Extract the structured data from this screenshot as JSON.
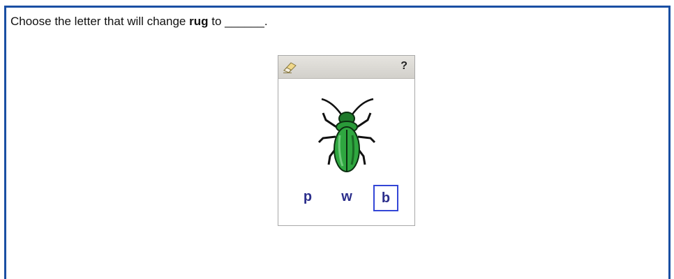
{
  "question": {
    "prefix": "Choose the letter that will change ",
    "word": "rug",
    "suffix": " to ______."
  },
  "widget": {
    "help_label": "?",
    "eraser_icon": "eraser-icon",
    "picture_icon": "beetle-icon",
    "choices": [
      {
        "letter": "p",
        "selected": false
      },
      {
        "letter": "w",
        "selected": false
      },
      {
        "letter": "b",
        "selected": true
      }
    ],
    "accent_color": "#3346d6"
  }
}
